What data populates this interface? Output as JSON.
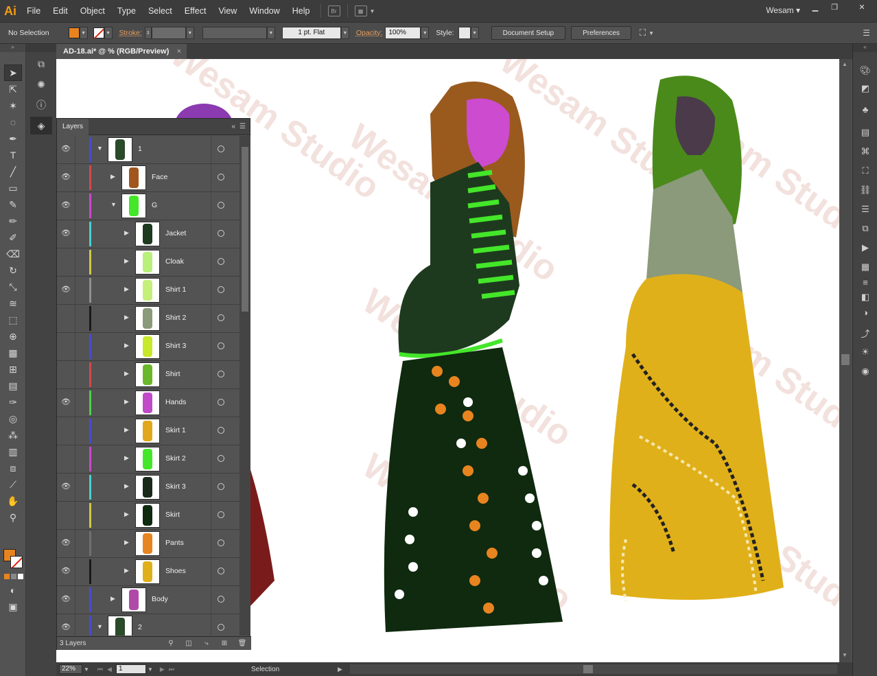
{
  "app": {
    "logo": "Ai",
    "menus": [
      "File",
      "Edit",
      "Object",
      "Type",
      "Select",
      "Effect",
      "View",
      "Window",
      "Help"
    ],
    "bridge_label": "Br",
    "user": "Wesam"
  },
  "control_bar": {
    "selection_state": "No Selection",
    "stroke_label": "Stroke:",
    "stroke_weight": "",
    "brush_profile": "1 pt. Flat",
    "opacity_label": "Opacity:",
    "opacity_value": "100%",
    "style_label": "Style:",
    "document_setup": "Document Setup",
    "preferences": "Preferences",
    "fill_color": "#e8841f"
  },
  "document": {
    "tab_title": "AD-18.ai* @ % (RGB/Preview)",
    "close_glyph": "×"
  },
  "layers_panel": {
    "title": "Layers",
    "footer": "3 Layers",
    "rows": [
      {
        "name": "1",
        "color": "#4a4ad0",
        "indent": 0,
        "expanded": true,
        "visible": true
      },
      {
        "name": "Face",
        "color": "#d04a4a",
        "indent": 1,
        "expanded": false,
        "visible": true
      },
      {
        "name": "G",
        "color": "#c84ac8",
        "indent": 1,
        "expanded": true,
        "visible": true
      },
      {
        "name": "Jacket",
        "color": "#4ad0d0",
        "indent": 2,
        "expanded": false,
        "visible": true
      },
      {
        "name": "Cloak",
        "color": "#d0c84a",
        "indent": 2,
        "expanded": false,
        "visible": false
      },
      {
        "name": "Shirt 1",
        "color": "#909090",
        "indent": 2,
        "expanded": false,
        "visible": true
      },
      {
        "name": "Shirt 2",
        "color": "#1a1a1a",
        "indent": 2,
        "expanded": false,
        "visible": false
      },
      {
        "name": "Shirt 3",
        "color": "#4a4ad0",
        "indent": 2,
        "expanded": false,
        "visible": false
      },
      {
        "name": "Shirt",
        "color": "#d04a4a",
        "indent": 2,
        "expanded": false,
        "visible": false
      },
      {
        "name": "Hands",
        "color": "#4ad04a",
        "indent": 2,
        "expanded": false,
        "visible": true
      },
      {
        "name": "Skirt 1",
        "color": "#4a4ad0",
        "indent": 2,
        "expanded": false,
        "visible": false
      },
      {
        "name": "Skirt 2",
        "color": "#c84ac8",
        "indent": 2,
        "expanded": false,
        "visible": false
      },
      {
        "name": "Skirt 3",
        "color": "#4ad0d0",
        "indent": 2,
        "expanded": false,
        "visible": true
      },
      {
        "name": "Skirt",
        "color": "#d0c84a",
        "indent": 2,
        "expanded": false,
        "visible": false
      },
      {
        "name": "Pants",
        "color": "#707070",
        "indent": 2,
        "expanded": false,
        "visible": true
      },
      {
        "name": "Shoes",
        "color": "#1a1a1a",
        "indent": 2,
        "expanded": false,
        "visible": true
      },
      {
        "name": "Body",
        "color": "#4a4ad0",
        "indent": 1,
        "expanded": false,
        "visible": true
      },
      {
        "name": "2",
        "color": "#4a4ad0",
        "indent": 0,
        "expanded": true,
        "visible": true
      }
    ]
  },
  "status_bar": {
    "zoom": "22%",
    "page": "1",
    "tool_status": "Selection"
  },
  "watermark_text": "Wesam Studio"
}
